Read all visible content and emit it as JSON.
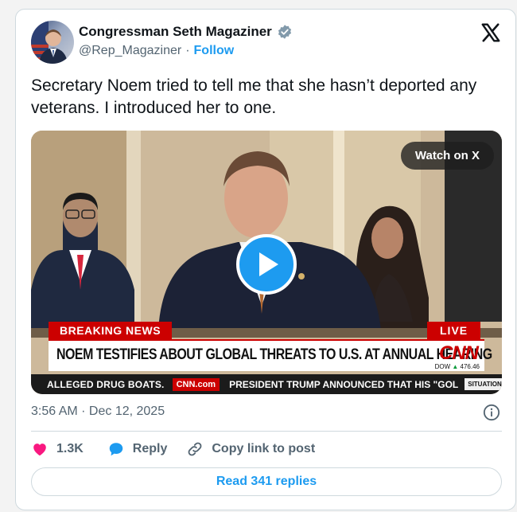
{
  "author": {
    "name": "Congressman Seth Magaziner",
    "handle": "@Rep_Magaziner",
    "separator": "·",
    "follow_label": "Follow",
    "verified_icon": "verified-badge-icon",
    "logo_icon": "x-logo-icon"
  },
  "tweet": {
    "text": "Secretary Noem tried to tell me that she hasn’t deported any veterans. I introduced her to one."
  },
  "media": {
    "watch_label": "Watch on X",
    "play_icon": "play-icon",
    "breaking_label": "BREAKING NEWS",
    "live_label": "LIVE",
    "headline": "NOEM TESTIFIES ABOUT GLOBAL THREATS TO U.S. AT ANNUAL HEARING",
    "network_logo": "CNN",
    "dow_label": "DOW",
    "dow_arrow": "▲",
    "dow_value": "476.46",
    "ticker_left": "ALLEGED DRUG BOATS.",
    "ticker_brand": "CNN.com",
    "ticker_right": "PRESIDENT TRUMP ANNOUNCED THAT HIS \"GOL",
    "ticker_tag": "SITUATION ROOM"
  },
  "meta": {
    "timestamp": "3:56 AM · Dec 12, 2025",
    "info_icon": "info-icon"
  },
  "actions": {
    "like_count": "1.3K",
    "reply_label": "Reply",
    "copy_label": "Copy link to post",
    "read_replies_label": "Read 341 replies"
  },
  "colors": {
    "accent": "#1d9bf0",
    "like": "#f91880",
    "breaking_red": "#cc0000",
    "muted_text": "#536471"
  }
}
